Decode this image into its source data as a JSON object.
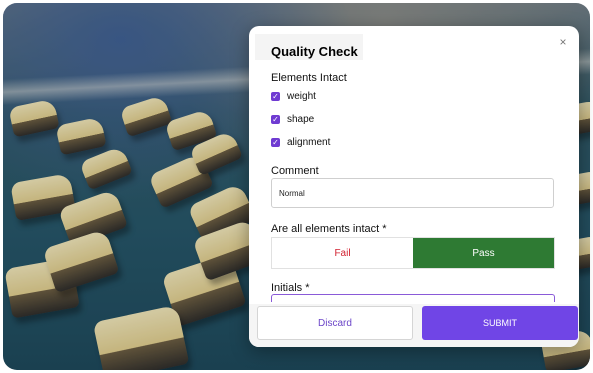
{
  "modal": {
    "title": "Quality Check",
    "close_glyph": "×",
    "elements_intact": {
      "label": "Elements Intact",
      "items": [
        {
          "label": "weight",
          "checked": true
        },
        {
          "label": "shape",
          "checked": true
        },
        {
          "label": "alignment",
          "checked": true
        }
      ]
    },
    "comment": {
      "label": "Comment",
      "value": "Normal"
    },
    "all_intact": {
      "label": "Are all elements intact *",
      "fail_label": "Fail",
      "pass_label": "Pass",
      "selected": "Pass"
    },
    "initials": {
      "label": "Initials *"
    },
    "actions": {
      "discard_label": "Discard",
      "submit_label": "SUBMIT"
    }
  },
  "colors": {
    "accent": "#7045e6",
    "checkbox": "#6f3bd2",
    "pass": "#2e7a33",
    "fail_text": "#d11f2f"
  }
}
